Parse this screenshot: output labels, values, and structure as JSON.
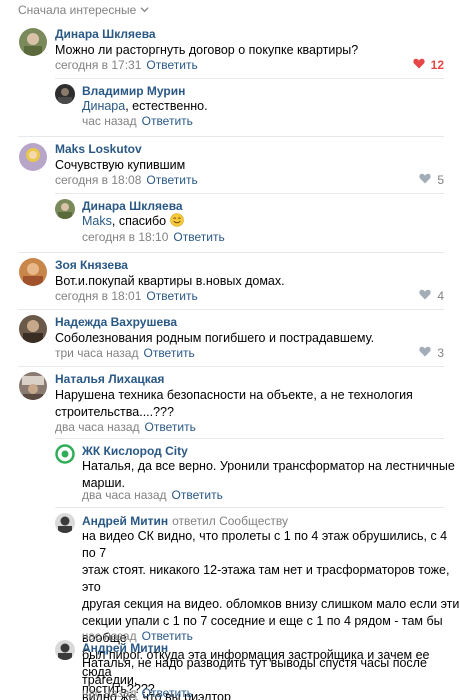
{
  "sort": {
    "label": "Сначала интересные"
  },
  "comments": [
    {
      "author": "Динара Шкляева",
      "text": "Можно ли расторгнуть договор о покупке квартиры?",
      "time": "сегодня в 17:31",
      "reply": "Ответить",
      "likes": "12",
      "liked": true,
      "avatar_color": "#7a8a5a"
    },
    {
      "author": "Владимир Мурин",
      "mention": "Динара",
      "text": ", естественно.",
      "time": "час назад",
      "reply": "Ответить",
      "avatar_color": "#2e2e2e"
    },
    {
      "author": "Maks Loskutov",
      "text": "Сочувствую купившим",
      "time": "сегодня в 18:08",
      "reply": "Ответить",
      "likes": "5",
      "avatar_color": "#b8a6c9"
    },
    {
      "author": "Динара Шкляева",
      "mention": "Maks",
      "text": ", спасибо",
      "time": "сегодня в 18:10",
      "reply": "Ответить",
      "avatar_color": "#7a8a5a"
    },
    {
      "author": "Зоя Князева",
      "text": "Вот.и.покупай квартиры в.новых домах.",
      "time": "сегодня в 18:01",
      "reply": "Ответить",
      "likes": "4",
      "avatar_color": "#c9864a"
    },
    {
      "author": "Надежда Вахрушева",
      "text": "Соболезнования родным погибшего и пострадавшему.",
      "time": "три часа назад",
      "reply": "Ответить",
      "likes": "3",
      "avatar_color": "#6b5a4a"
    },
    {
      "author": "Наталья Лихацкая",
      "text_lines": [
        "Нарушена техника безопасности на объекте, а не технология",
        "строительства....???"
      ],
      "time": "два часа назад",
      "reply": "Ответить",
      "avatar_color": "#8a7a72"
    },
    {
      "author": "ЖК Кислород City",
      "text_lines": [
        "Наталья, да все верно. Уронили трансформатор на лестничные",
        "марши."
      ],
      "time": "два часа назад",
      "reply": "Ответить",
      "avatar_color": "#2fae57"
    },
    {
      "author": "Андрей Митин",
      "replied_to": "ответил Сообществу",
      "text_lines": [
        "на видео СК видно, что пролеты с 1 по 4 этаж обрушились, с 4 по 7",
        "этаж стоят. никакого 12-этажа там нет и трасформаторов тоже, это",
        "другая секция на видео. обломков внизу слишком мало если эти",
        "секции упали с 1 по 7 соседние и еще с 1 по 4 рядом - там бы вообще",
        "был пирог. откуда эта информация застройщика и зачем ее сюда",
        "постить????"
      ],
      "time": "час назад",
      "reply": "Ответить",
      "avatar_color": "#3a3a3a"
    },
    {
      "author": "Андрей Митин",
      "text_lines": [
        "Наталья, не надо разводить тут выводы спустя часы после трагедии,",
        "видно же, что вы риэлтор"
      ],
      "time": "час назад",
      "reply": "Ответить",
      "avatar_color": "#3a3a3a"
    }
  ]
}
